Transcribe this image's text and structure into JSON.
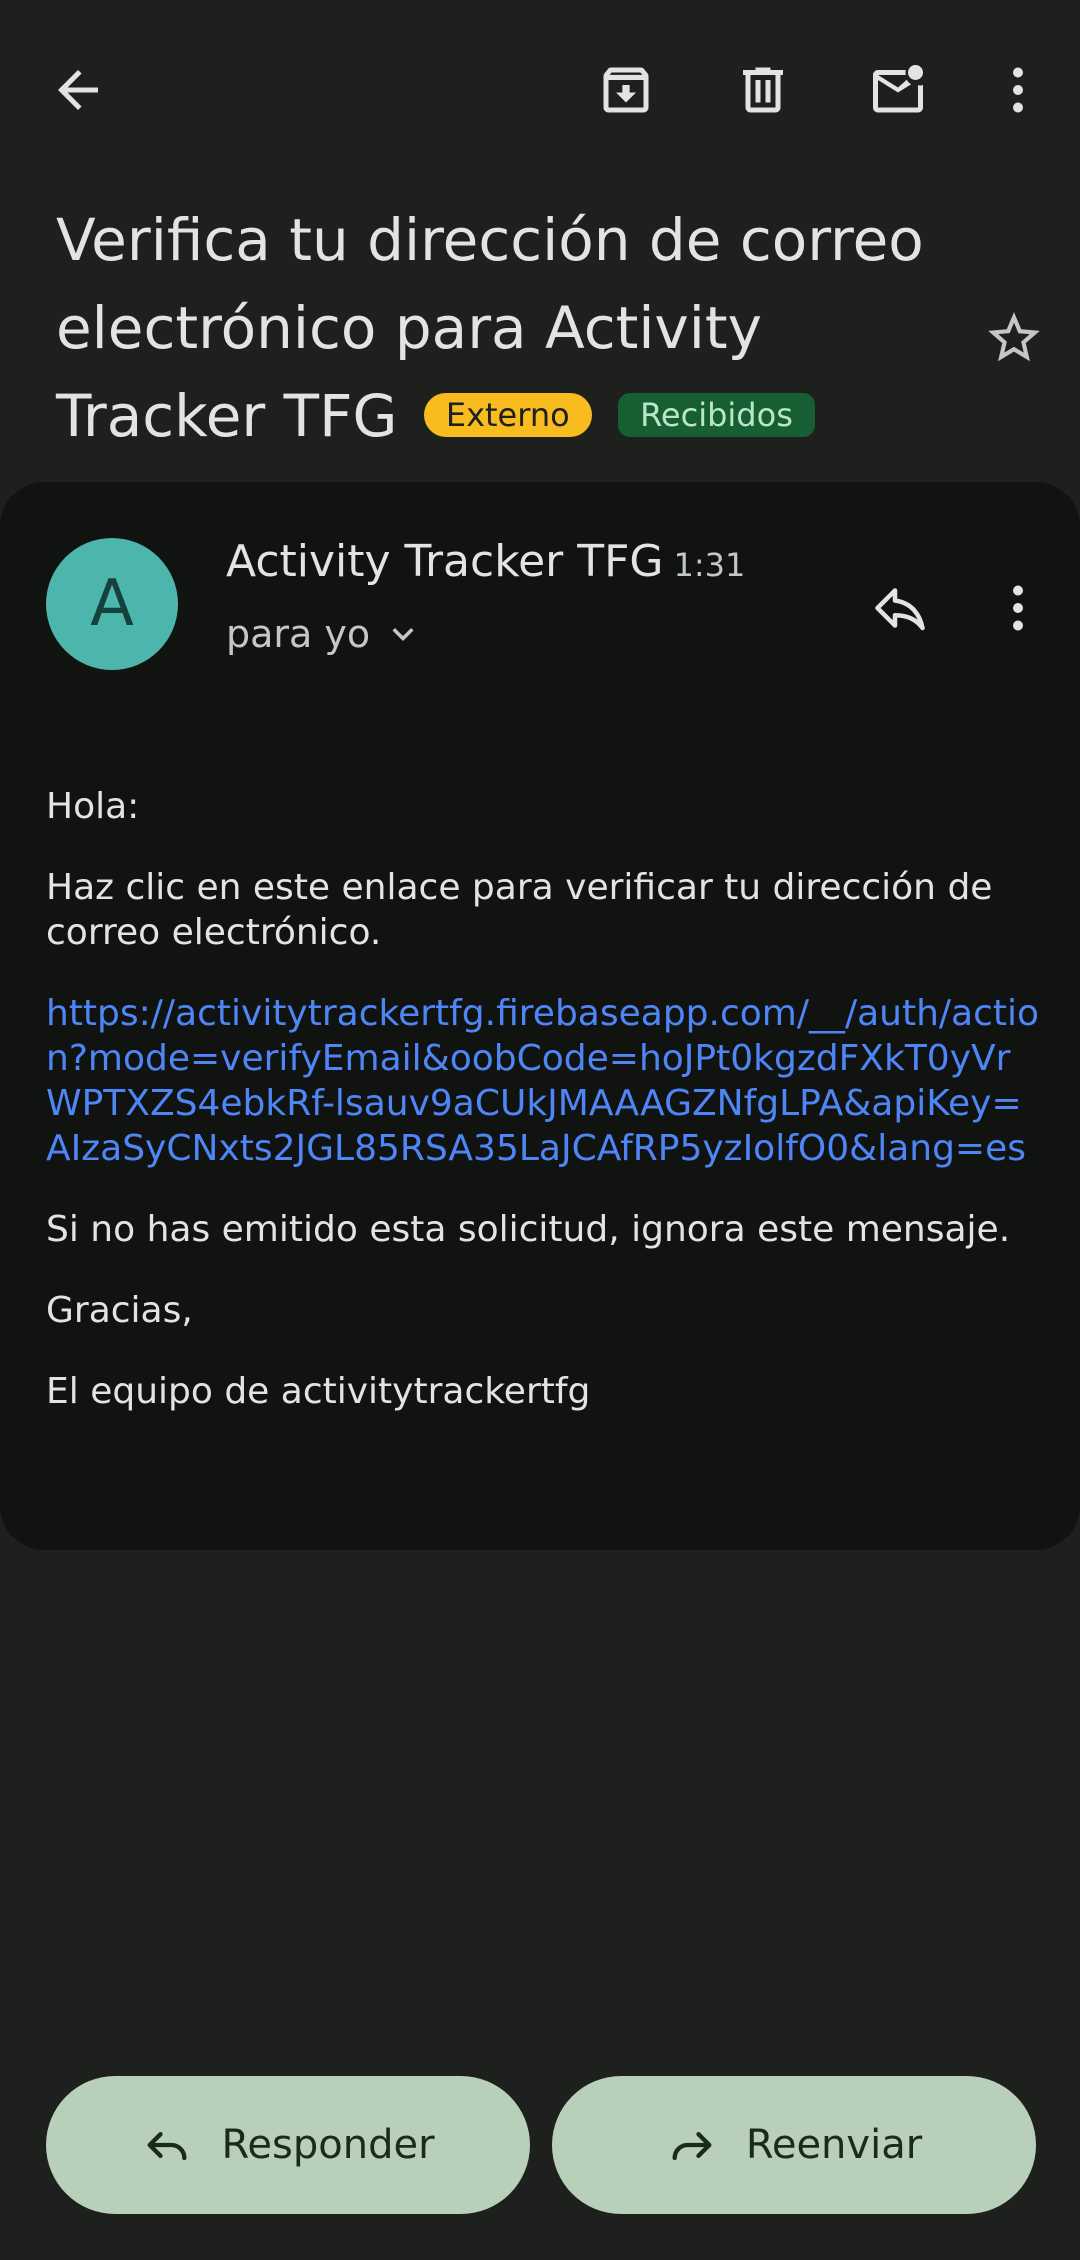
{
  "toolbar": {
    "back_icon": "arrow-left-icon",
    "archive_icon": "archive-icon",
    "delete_icon": "trash-icon",
    "unread_icon": "mark-unread-icon",
    "more_icon": "more-vert-icon"
  },
  "subject": {
    "text": "Verifica tu dirección de correo electrónico para Activity Tracker TFG",
    "labels": [
      "Externo",
      "Recibidos"
    ],
    "star_icon": "star-outline-icon"
  },
  "message": {
    "avatar_letter": "A",
    "avatar_color": "#4db6ac",
    "sender": "Activity Tracker TFG",
    "time": "1:31",
    "recipient": "para yo",
    "greeting": "Hola:",
    "instruction": "Haz clic en este enlace para verificar tu dirección de correo electrónico.",
    "link": "https://activitytrackertfg.firebaseapp.com/__/auth/action?mode=verifyEmail&oobCode=hoJPt0kgzdFXkT0yVrWPTXZS4ebkRf-lsauv9aCUkJMAAAGZNfgLPA&apiKey=AIzaSyCNxts2JGL85RSA35LaJCAfRP5yzIolfO0&lang=es",
    "ignore_text": "Si no has emitido esta solicitud, ignora este mensaje.",
    "thanks": "Gracias,",
    "signature": "El equipo de activitytrackertfg"
  },
  "actions": {
    "reply_label": "Responder",
    "forward_label": "Reenviar"
  },
  "colors": {
    "background": "#1e201e",
    "card": "#111311",
    "link": "#4f86f7",
    "chip_externo": "#f8bc1e",
    "chip_recibidos": "#175f33",
    "button": "#b8d0b9"
  }
}
